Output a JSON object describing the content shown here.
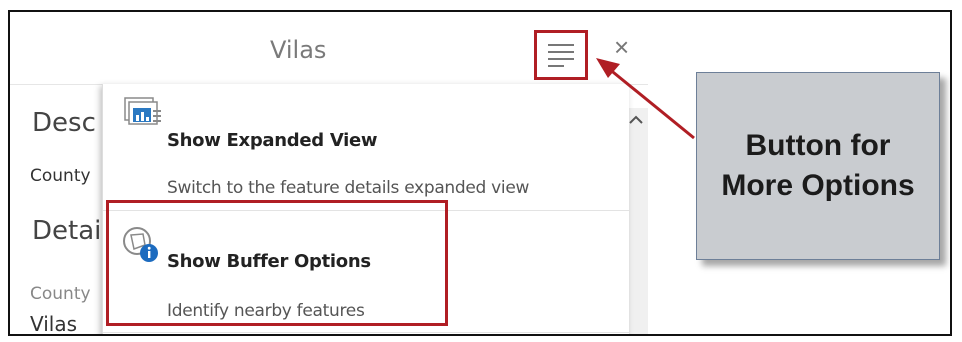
{
  "panel": {
    "title": "Vilas",
    "close_glyph": "×",
    "menu_icon": "hamburger-lines-icon",
    "background_labels": {
      "desc_heading": "Desc",
      "county_label_1": "County",
      "detail_heading": "Detai",
      "county_label_2": "County",
      "county_value": "Vilas"
    }
  },
  "dropdown": {
    "items": [
      {
        "title": "Show Expanded View",
        "description": "Switch to the feature details expanded view",
        "icon": "expanded-view-icon"
      },
      {
        "title": "Show Buffer Options",
        "description": "Identify nearby features",
        "icon": "buffer-info-icon"
      }
    ]
  },
  "callout": {
    "line1": "Button for",
    "line2": "More Options"
  },
  "colors": {
    "highlight_red": "#b01e24",
    "callout_fill": "#c9ccd0",
    "callout_border": "#6d7f98"
  }
}
